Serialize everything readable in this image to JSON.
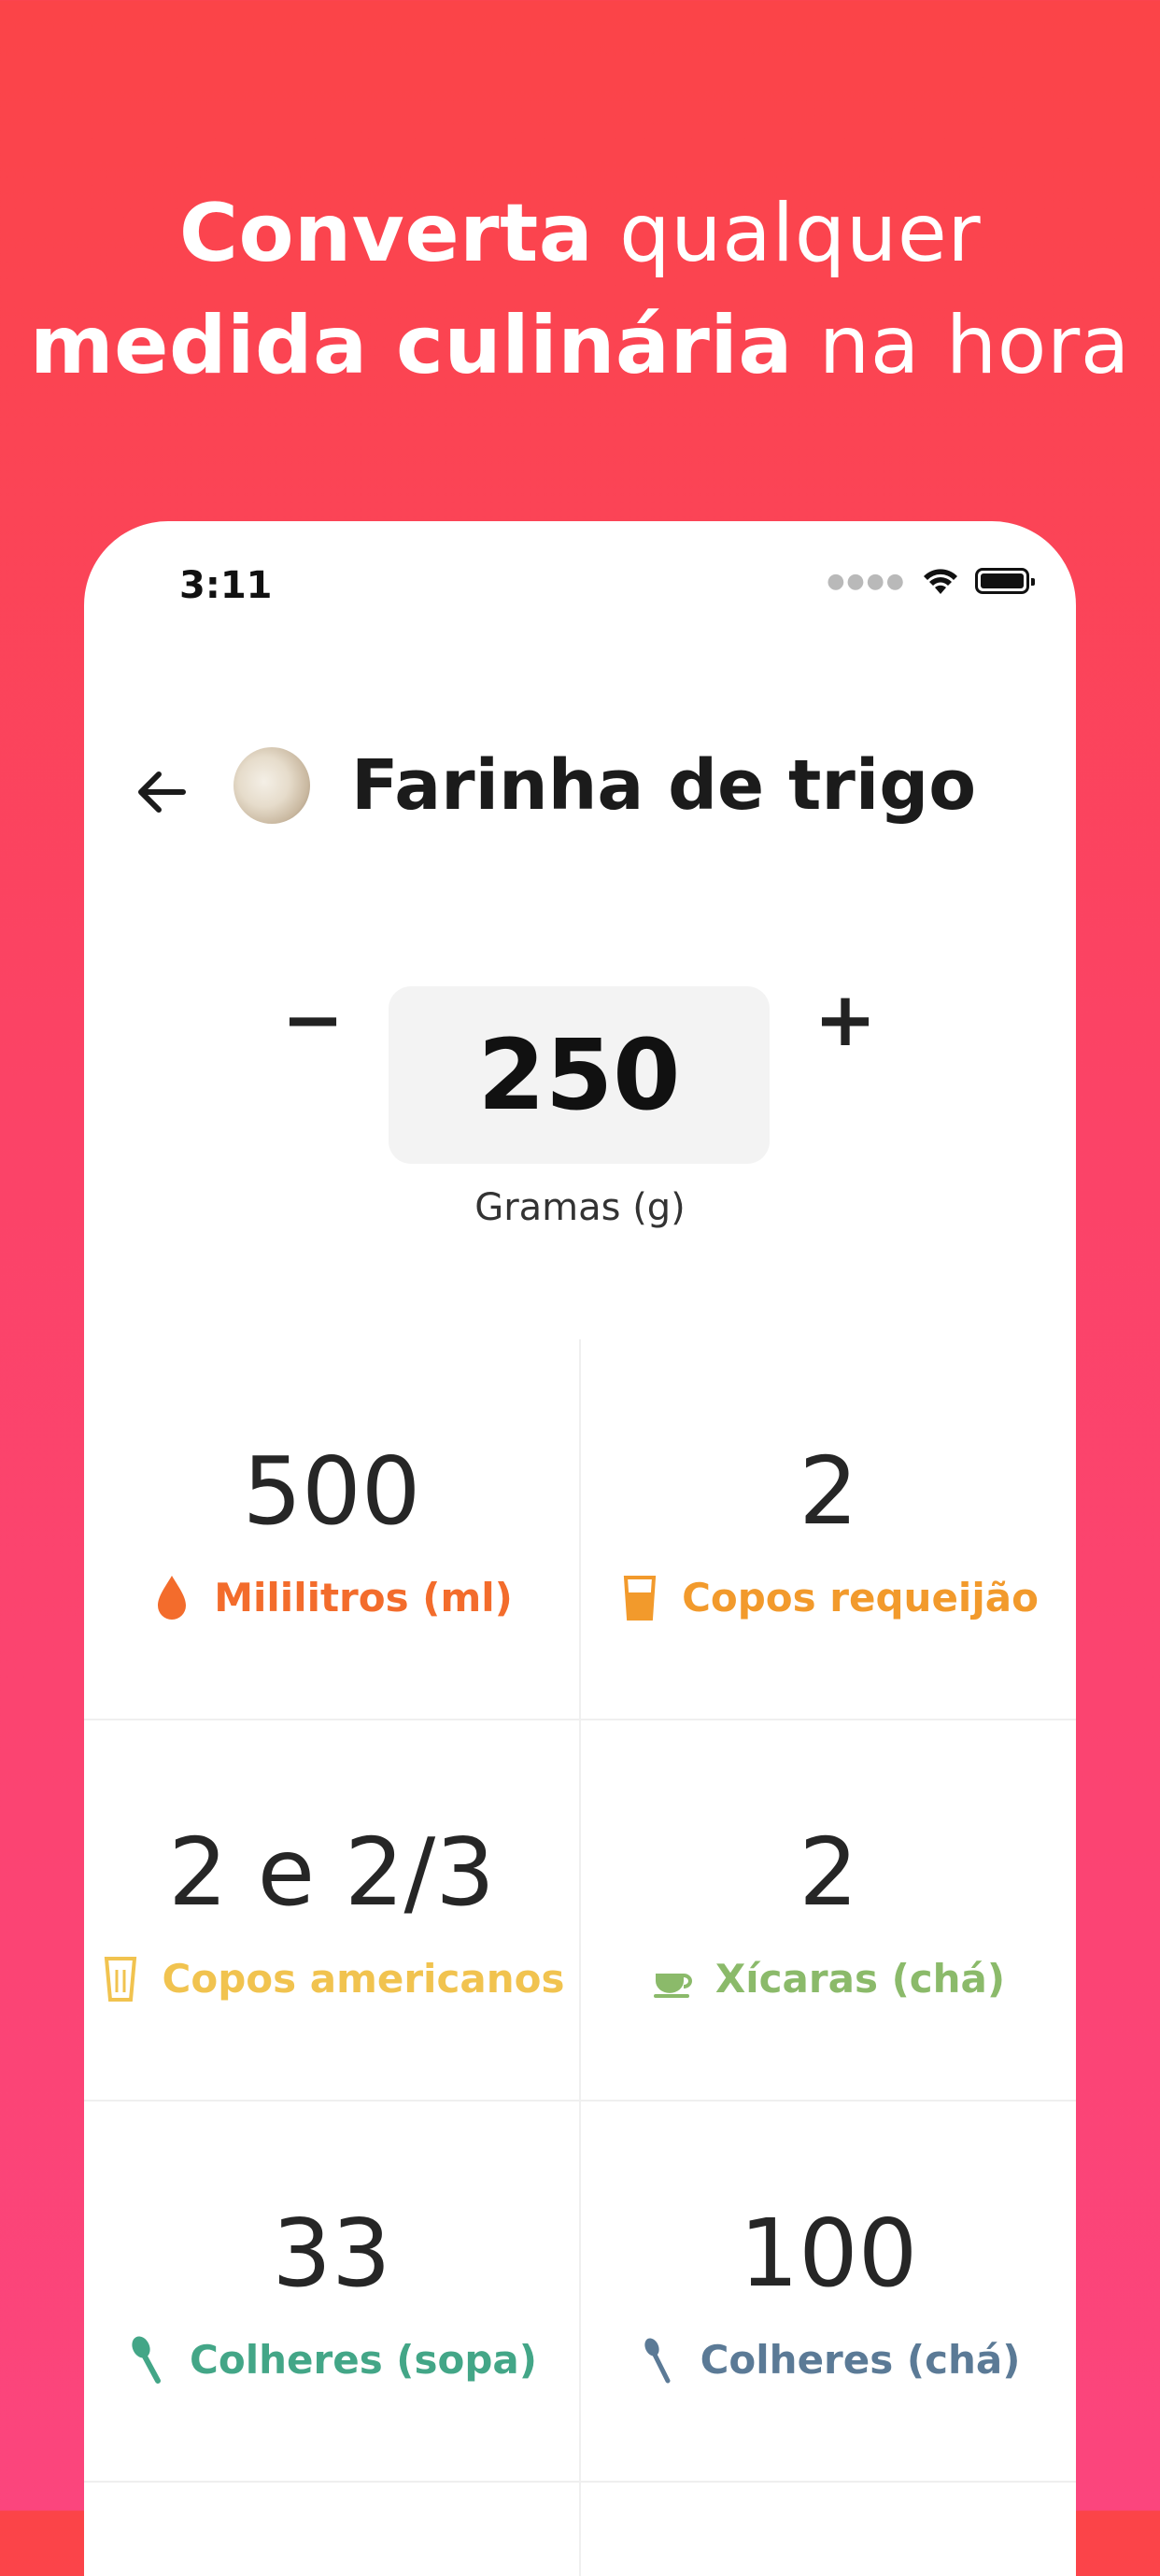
{
  "headline": {
    "line1_bold": "Converta",
    "line1_rest": "qualquer",
    "line2_bold": "medida culinária",
    "line2_rest": "na hora"
  },
  "status_bar": {
    "time": "3:11"
  },
  "header": {
    "title": "Farinha de trigo"
  },
  "stepper": {
    "minus": "−",
    "value": "250",
    "plus": "+",
    "unit": "Gramas (g)"
  },
  "conversions": [
    {
      "value": "500",
      "label": "Mililitros (ml)",
      "icon": "drop-icon",
      "color": "#f36c2c"
    },
    {
      "value": "2",
      "label": "Copos requeijão",
      "icon": "glass-icon",
      "color": "#f29a2c"
    },
    {
      "value": "2 e 2/3",
      "label": "Copos americanos",
      "icon": "cup-icon",
      "color": "#f1c34f"
    },
    {
      "value": "2",
      "label": "Xícaras (chá)",
      "icon": "teacup-icon",
      "color": "#8bba6a"
    },
    {
      "value": "33",
      "label": "Colheres (sopa)",
      "icon": "spoon-icon",
      "color": "#43a687"
    },
    {
      "value": "100",
      "label": "Colheres (chá)",
      "icon": "teaspoon-icon",
      "color": "#5b7a96"
    }
  ]
}
